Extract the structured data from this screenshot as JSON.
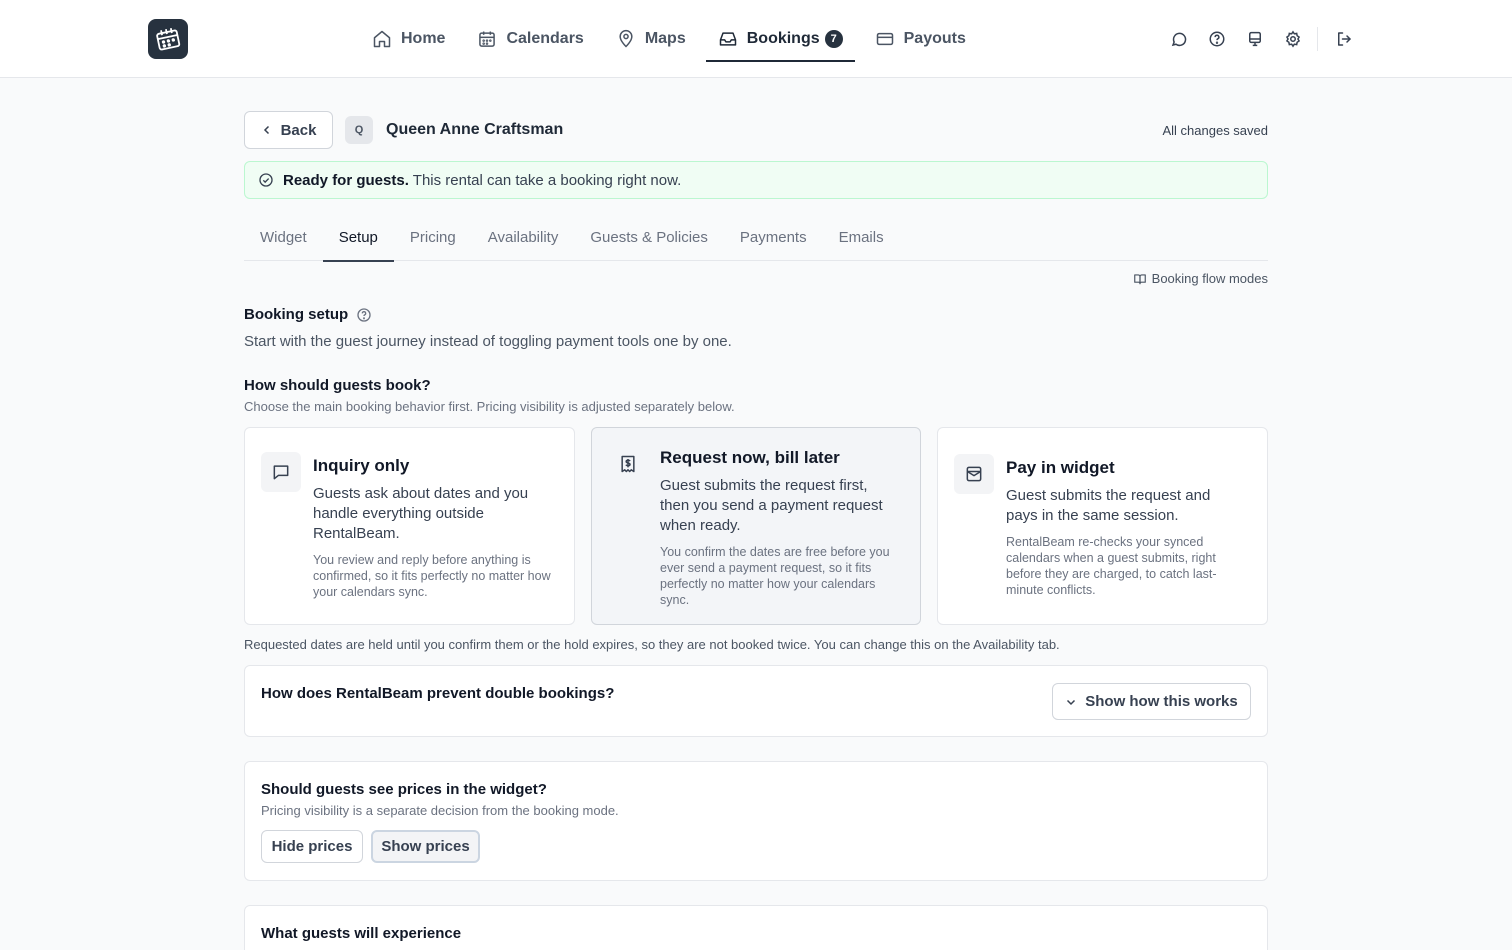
{
  "nav": {
    "items": [
      {
        "label": "Home",
        "icon": "home-icon"
      },
      {
        "label": "Calendars",
        "icon": "calendar-icon"
      },
      {
        "label": "Maps",
        "icon": "map-pin-icon"
      },
      {
        "label": "Bookings",
        "icon": "inbox-icon",
        "badge": "7",
        "active": true
      },
      {
        "label": "Payouts",
        "icon": "credit-card-icon"
      }
    ],
    "right_icons": [
      "chat-icon",
      "help-icon",
      "monitor-icon",
      "gear-icon",
      "logout-icon"
    ]
  },
  "header": {
    "back_label": "Back",
    "property_initial": "Q",
    "property_name": "Queen Anne Craftsman",
    "save_status": "All changes saved"
  },
  "ready_banner": {
    "strong": "Ready for guests.",
    "text": "This rental can take a booking right now."
  },
  "tabs": [
    "Widget",
    "Setup",
    "Pricing",
    "Availability",
    "Guests & Policies",
    "Payments",
    "Emails"
  ],
  "active_tab": "Setup",
  "flow_link": "Booking flow modes",
  "booking_setup": {
    "title": "Booking setup",
    "subtitle": "Start with the guest journey instead of toggling payment tools one by one.",
    "question": "How should guests book?",
    "question_sub": "Choose the main booking behavior first. Pricing visibility is adjusted separately below.",
    "options": [
      {
        "title": "Inquiry only",
        "description": "Guests ask about dates and you handle everything outside RentalBeam.",
        "note": "You review and reply before anything is confirmed, so it fits perfectly no matter how your calendars sync.",
        "icon": "message-square-icon"
      },
      {
        "title": "Request now, bill later",
        "description": "Guest submits the request first, then you send a payment request when ready.",
        "note": "You confirm the dates are free before you ever send a payment request, so it fits perfectly no matter how your calendars sync.",
        "icon": "receipt-dollar-icon",
        "selected": true
      },
      {
        "title": "Pay in widget",
        "description": "Guest submits the request and pays in the same session.",
        "note": "RentalBeam re-checks your synced calendars when a guest submits, right before they are charged, to catch last-minute conflicts.",
        "icon": "wallet-icon"
      }
    ],
    "hold_note": "Requested dates are held until you confirm them or the hold expires, so they are not booked twice. You can change this on the Availability tab."
  },
  "double_booking": {
    "title": "How does RentalBeam prevent double bookings?",
    "button": "Show how this works"
  },
  "prices": {
    "title": "Should guests see prices in the widget?",
    "subtitle": "Pricing visibility is a separate decision from the booking mode.",
    "options": [
      "Hide prices",
      "Show prices"
    ],
    "selected": "Show prices"
  },
  "experience": {
    "title": "What guests will experience"
  }
}
